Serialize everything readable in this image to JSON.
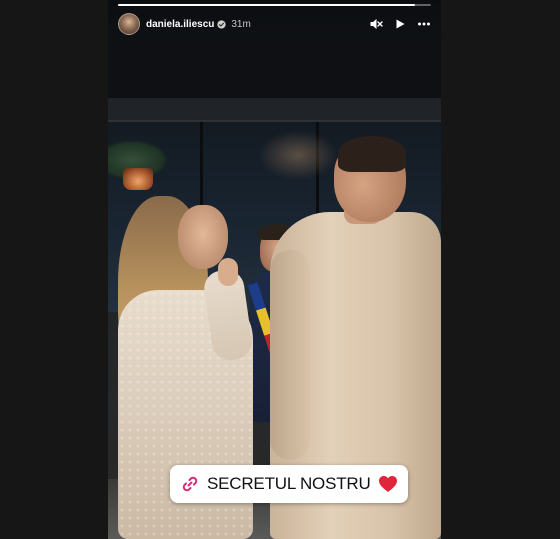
{
  "story": {
    "username": "daniela.iliescu",
    "timestamp": "31m",
    "progress": 0.95,
    "verified": true,
    "icons": {
      "avatar": "profile-avatar",
      "verified": "verified-badge-icon",
      "mute": "muted-speaker-icon",
      "play": "play-icon",
      "more": "more-options-icon"
    }
  },
  "sticker": {
    "link_icon": "link-icon",
    "text": "SECRETUL NOSTRU",
    "emoji": "heart",
    "heart_color": "#e0263a",
    "link_color": "#d62976"
  }
}
